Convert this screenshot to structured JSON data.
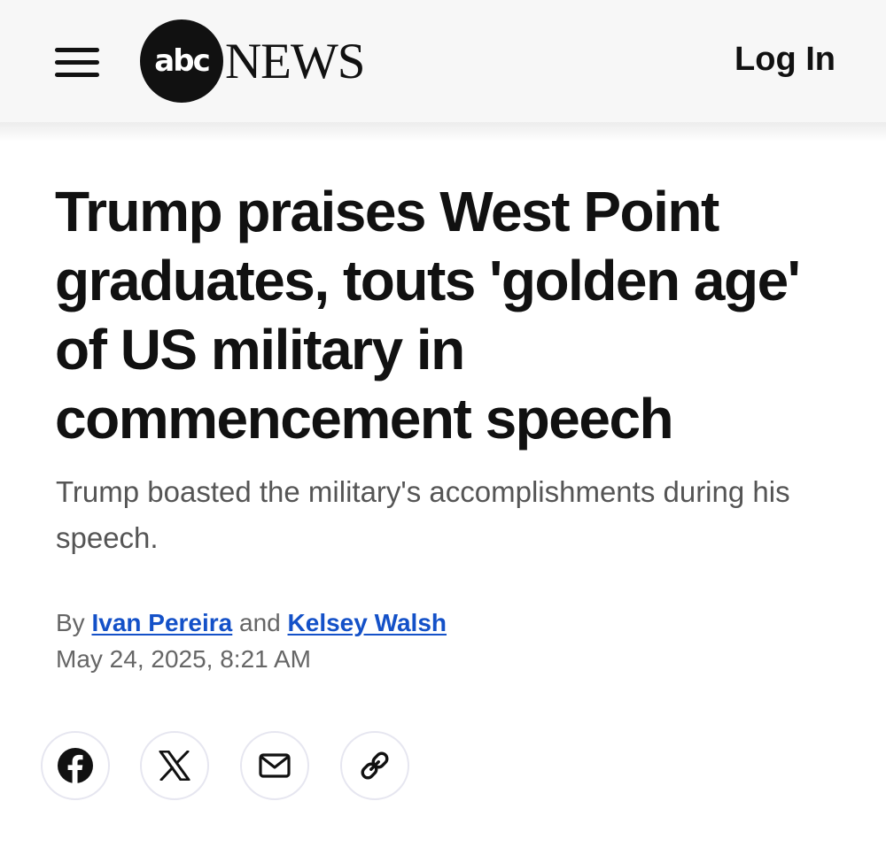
{
  "header": {
    "logo_mark": "abc",
    "logo_text": "NEWS",
    "login_label": "Log In"
  },
  "article": {
    "headline_lines": [
      "Trump praises West Point",
      "graduates, touts 'golden age'",
      "of US military in",
      "commencement speech"
    ],
    "subheadline_lines": [
      "Trump boasted the military's accomplishments during his",
      "speech."
    ],
    "byline": {
      "prefix": "By",
      "author1": "Ivan Pereira",
      "conjunction": "and",
      "author2": "Kelsey Walsh"
    },
    "date": "May 24, 2025, 8:21 AM"
  },
  "share_buttons": [
    {
      "icon": "facebook-icon"
    },
    {
      "icon": "x-icon"
    },
    {
      "icon": "mail-icon"
    },
    {
      "icon": "link-icon"
    }
  ],
  "colors": {
    "header_bg": "#f7f7f7",
    "text": "#111111",
    "link": "#1451c8",
    "muted": "#666666"
  }
}
